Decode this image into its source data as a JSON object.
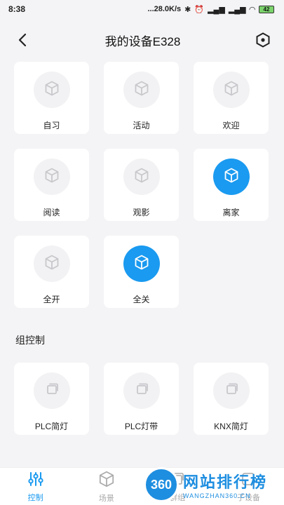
{
  "status_bar": {
    "time": "8:38",
    "net_speed": "...28.0K/s",
    "battery": "42"
  },
  "header": {
    "title": "我的设备E328"
  },
  "scenes": [
    {
      "label": "自习",
      "active": false
    },
    {
      "label": "活动",
      "active": false
    },
    {
      "label": "欢迎",
      "active": false
    },
    {
      "label": "阅读",
      "active": false
    },
    {
      "label": "观影",
      "active": false
    },
    {
      "label": "离家",
      "active": true
    },
    {
      "label": "全开",
      "active": false
    },
    {
      "label": "全关",
      "active": true
    }
  ],
  "group_section": {
    "title": "组控制"
  },
  "groups": [
    {
      "label": "PLC简灯"
    },
    {
      "label": "PLC灯带"
    },
    {
      "label": "KNX简灯"
    }
  ],
  "tabs": [
    {
      "label": "控制",
      "active": true
    },
    {
      "label": "场景",
      "active": false
    },
    {
      "label": "群组",
      "active": false
    },
    {
      "label": "子设备",
      "active": false
    }
  ],
  "watermark": {
    "badge": "360",
    "main": "网站排行榜",
    "sub": "WANGZHAN360.CN"
  },
  "colors": {
    "accent": "#1a9af0",
    "background": "#f4f4f6"
  }
}
